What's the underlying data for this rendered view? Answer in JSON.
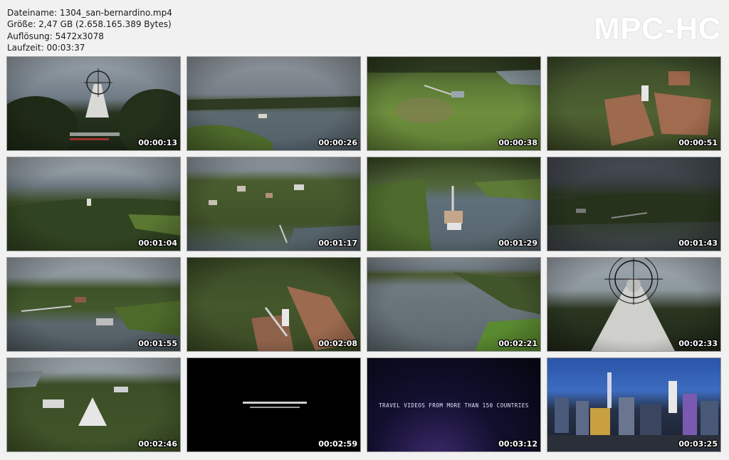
{
  "header": {
    "filename": "Dateiname: 1304_san-bernardino.mp4",
    "size": "Größe: 2,47 GB (2.658.165.389 Bytes)",
    "resolution": "Auflösung: 5472x3078",
    "duration": "Laufzeit: 00:03:37"
  },
  "logo": "MPC-HC",
  "thumbnails": [
    {
      "time": "00:00:13"
    },
    {
      "time": "00:00:26"
    },
    {
      "time": "00:00:38"
    },
    {
      "time": "00:00:51"
    },
    {
      "time": "00:01:04"
    },
    {
      "time": "00:01:17"
    },
    {
      "time": "00:01:29"
    },
    {
      "time": "00:01:43"
    },
    {
      "time": "00:01:55"
    },
    {
      "time": "00:02:08"
    },
    {
      "time": "00:02:21"
    },
    {
      "time": "00:02:33"
    },
    {
      "time": "00:02:46"
    },
    {
      "time": "00:02:59"
    },
    {
      "time": "00:03:12"
    },
    {
      "time": "00:03:25"
    }
  ],
  "frame_15_caption": "TRAVEL VIDEOS FROM MORE THAN 150 COUNTRIES"
}
